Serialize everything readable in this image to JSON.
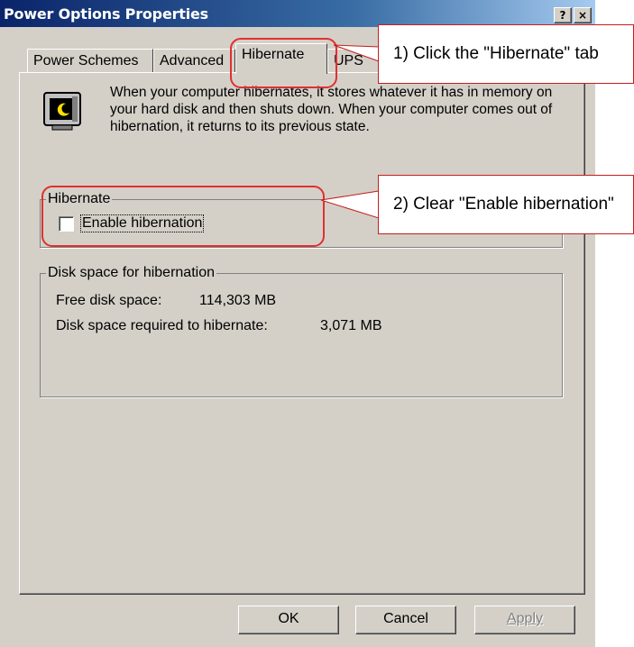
{
  "window": {
    "title": "Power Options Properties",
    "help_button": "?",
    "close_button": "×"
  },
  "tabs": [
    {
      "label": "Power Schemes",
      "active": false
    },
    {
      "label": "Advanced",
      "active": false
    },
    {
      "label": "Hibernate",
      "active": true
    },
    {
      "label": "UPS",
      "active": false
    }
  ],
  "hibernate_panel": {
    "intro_text": "When your computer hibernates, it stores whatever it has in memory on your hard disk and then shuts down. When your computer comes out of hibernation, it returns to its previous state.",
    "hibernate_group": {
      "label": "Hibernate",
      "checkbox_label": "Enable hibernation",
      "checked": false
    },
    "disk_group": {
      "label": "Disk space for hibernation",
      "free_label": "Free disk space:",
      "free_value": "114,303 MB",
      "required_label": "Disk space required to hibernate:",
      "required_value": "3,071 MB"
    }
  },
  "buttons": {
    "ok": "OK",
    "cancel": "Cancel",
    "apply": "Apply"
  },
  "callouts": {
    "step1": "1) Click the \"Hibernate\" tab",
    "step2": "2) Clear \"Enable hibernation\""
  },
  "colors": {
    "dialog_face": "#d4d0c8",
    "titlebar_start": "#0a246a",
    "titlebar_end": "#a6caf0",
    "annotation_red": "#e03030"
  }
}
